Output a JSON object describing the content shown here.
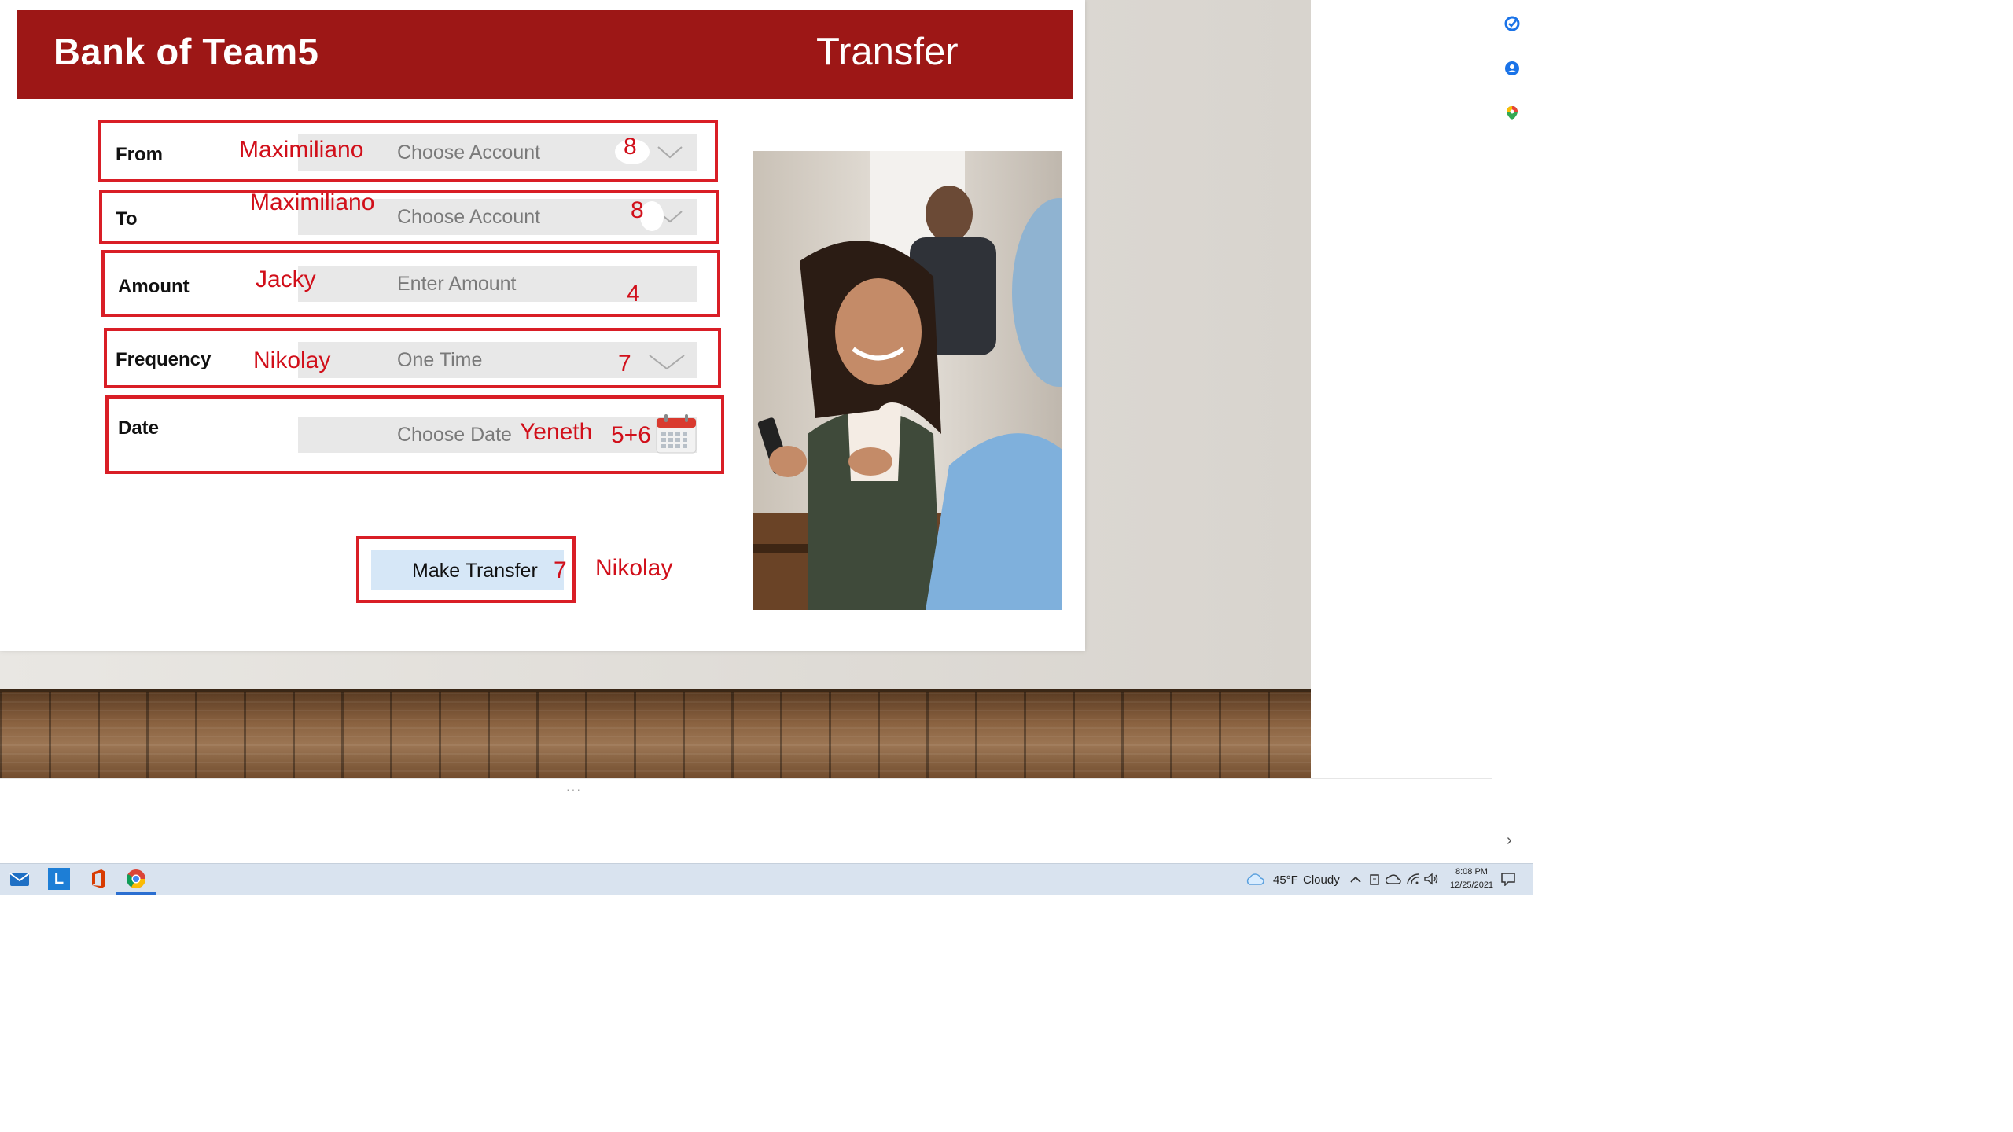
{
  "slide": {
    "bank_title": "Bank of Team5",
    "page_heading": "Transfer",
    "rows": {
      "from": {
        "label": "From",
        "placeholder": "Choose Account",
        "assignee": "Maximiliano",
        "number": "8"
      },
      "to": {
        "label": "To",
        "placeholder": "Choose Account",
        "assignee": "Maximiliano",
        "number": "8"
      },
      "amount": {
        "label": "Amount",
        "placeholder": "Enter Amount",
        "assignee": "Jacky",
        "number": "4"
      },
      "frequency": {
        "label": "Frequency",
        "value": "One Time",
        "assignee": "Nikolay",
        "number": "7"
      },
      "date": {
        "label": "Date",
        "placeholder": "Choose Date",
        "assignee": "Yeneth",
        "number": "5+6"
      }
    },
    "transfer_button": {
      "label": "Make Transfer",
      "number": "7",
      "assignee": "Nikolay"
    },
    "accent_color": "#9d1716",
    "annotation_color": "#d91e26"
  },
  "sidepanel": {
    "icons": [
      "tasks-icon",
      "contacts-icon",
      "maps-icon"
    ],
    "expand": "›"
  },
  "splitter": "···",
  "taskbar": {
    "apps": [
      "mail-icon",
      "lync-icon",
      "office-icon",
      "chrome-icon"
    ],
    "lync_letter": "L",
    "weather": {
      "temp": "45°F",
      "condition": "Cloudy"
    },
    "time": "8:08 PM",
    "date": "12/25/2021"
  }
}
